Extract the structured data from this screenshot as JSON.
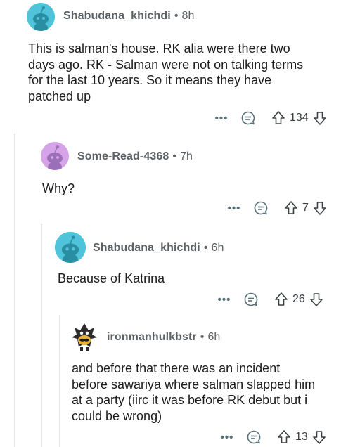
{
  "comments": [
    {
      "username": "Shabudana_khichdi",
      "separator": "•",
      "time": "8h",
      "avatar_color": "#4ec3d9",
      "body": "This is salman's house. RK alia were there two\ndays ago. RK - Salman were not on talking terms\nfor the last 10 years. So it means they have\npatched up",
      "votes": "134"
    },
    {
      "username": "Some-Read-4368",
      "separator": "•",
      "time": "7h",
      "avatar_color": "#d6a3e8",
      "body": "Why?",
      "votes": "7"
    },
    {
      "username": "Shabudana_khichdi",
      "separator": "•",
      "time": "6h",
      "avatar_color": "#4ec3d9",
      "body": "Because of Katrina",
      "votes": "26"
    },
    {
      "username": "ironmanhulkbstr",
      "separator": "•",
      "time": "6h",
      "avatar_color": "#ffffff",
      "body": "and before that there was an incident\nbefore sawariya where salman slapped him\nat a party (iirc it was before RK debut but i\ncould be wrong)",
      "votes": "13"
    }
  ],
  "actions": {
    "more_label": "•••",
    "reply_icon": "speech-bubble-icon",
    "upvote_icon": "arrow-up-icon",
    "downvote_icon": "arrow-down-icon"
  },
  "colors": {
    "thread_line": "#e3e5e8",
    "icon": "#576f76",
    "username": "#5c6166"
  }
}
